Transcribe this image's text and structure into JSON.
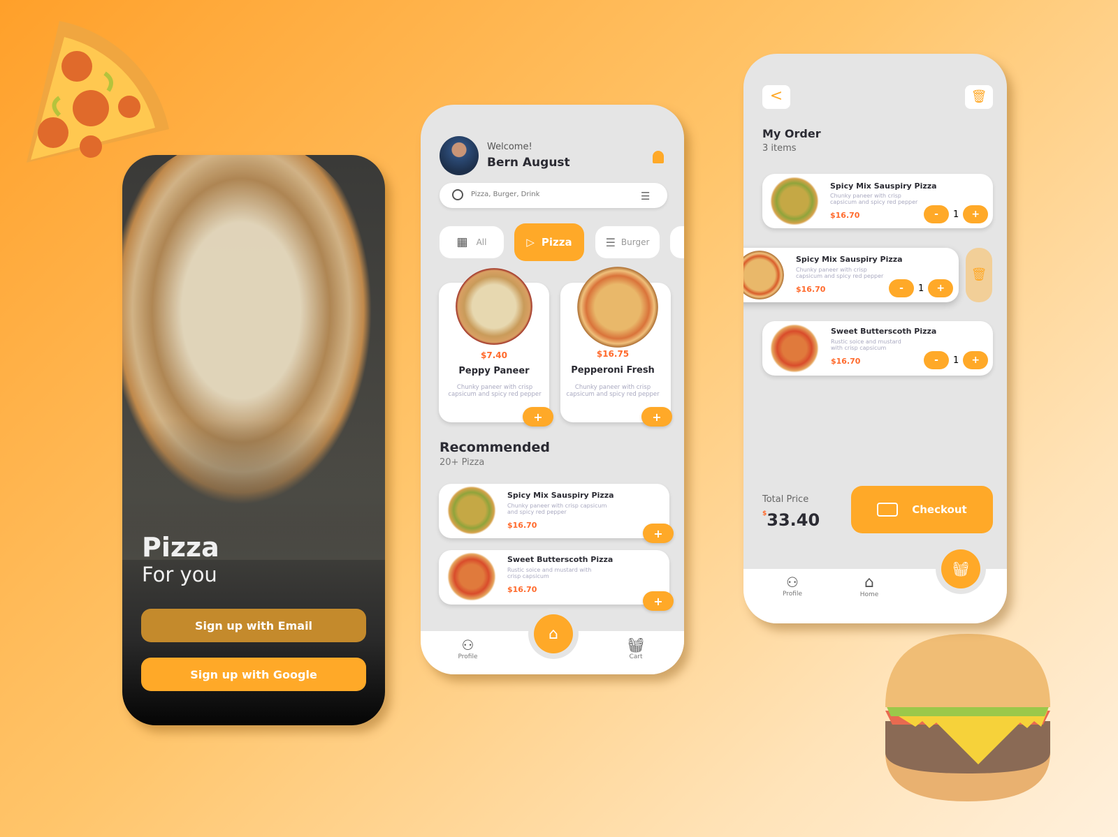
{
  "signup": {
    "title": "Pizza",
    "subtitle": "For you",
    "email_button": "Sign up with Email",
    "google_button": "Sign up with Google"
  },
  "home": {
    "welcome": "Welcome!",
    "user_name": "Bern August",
    "search_placeholder": "Pizza, Burger, Drink",
    "categories": [
      {
        "label": "All",
        "icon": "grid-icon"
      },
      {
        "label": "Pizza",
        "icon": "pizza-icon",
        "active": true
      },
      {
        "label": "Burger",
        "icon": "burger-icon"
      }
    ],
    "featured": [
      {
        "price": "$7.40",
        "name": "Peppy Paneer",
        "desc": "Chunky paneer with crisp capsicum and spicy red pepper"
      },
      {
        "price": "$16.75",
        "name": "Pepperoni Fresh",
        "desc": "Chunky paneer with crisp capsicum and spicy red pepper"
      }
    ],
    "recommended_title": "Recommended",
    "recommended_count": "20+ Pizza",
    "recommended": [
      {
        "name": "Spicy Mix Sauspiry Pizza",
        "desc": "Chunky paneer with crisp capsicum and spicy red pepper",
        "price": "$16.70"
      },
      {
        "name": "Sweet Butterscoth Pizza",
        "desc": "Rustic soice and mustard with crisp capsicum",
        "price": "$16.70"
      }
    ],
    "nav": {
      "profile": "Profile",
      "cart": "Cart"
    },
    "add_label": "+"
  },
  "order": {
    "title": "My Order",
    "count": "3 items",
    "items": [
      {
        "name": "Spicy Mix Sauspiry Pizza",
        "desc": "Chunky paneer with crisp capsicum and spicy red pepper",
        "price": "$16.70",
        "qty": "1"
      },
      {
        "name": "Spicy Mix Sauspiry Pizza",
        "desc": "Chunky paneer with crisp capsicum and spicy red pepper",
        "price": "$16.70",
        "qty": "1"
      },
      {
        "name": "Sweet Butterscoth Pizza",
        "desc": "Rustic soice and mustard with crisp capsicum",
        "price": "$16.70",
        "qty": "1"
      }
    ],
    "minus": "-",
    "plus": "+",
    "total_label": "Total Price",
    "currency": "$",
    "total": "33.40",
    "checkout": "Checkout",
    "nav": {
      "profile": "Profile",
      "home": "Home"
    }
  },
  "colors": {
    "accent": "#ffa928",
    "price": "#ff6a2c",
    "email_button": "#c48a2c"
  }
}
